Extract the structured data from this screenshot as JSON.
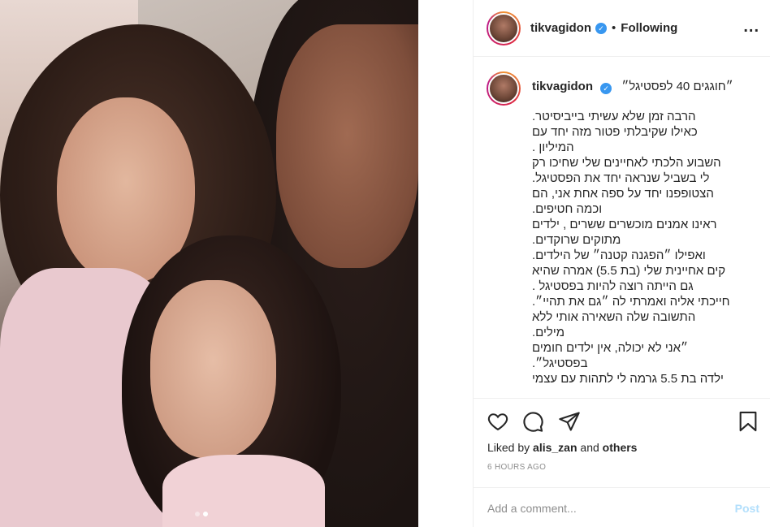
{
  "post": {
    "username": "tikvagidon",
    "separator": "•",
    "follow_status": "Following",
    "more": "...",
    "caption_title": "״חוגגים 40 לפסטיגל״",
    "caption_lines": [
      "הרבה זמן שלא עשיתי בייביסיטר.",
      "כאילו שקיבלתי פטור מזה יחד עם",
      "המיליון .",
      "השבוע הלכתי לאחיינים שלי שחיכו רק",
      "לי בשביל שנראה יחד את הפסטיגל.",
      "הצטופפנו יחד על ספה אחת אני, הם",
      "וכמה חטיפים.",
      "ראינו אמנים מוכשרים ששרים , ילדים",
      "מתוקים שרוקדים.",
      "ואפילו ״הפגנה קטנה״ של הילדים.",
      "קים אחיינית שלי (בת 5.5) אמרה שהיא",
      "גם הייתה רוצה להיות בפסטיגל .",
      "חייכתי אליה ואמרתי לה ״גם את תהיי״.",
      "התשובה שלה השאירה אותי ללא",
      "מילים.",
      "״אני לא יכולה, אין ילדים חומים",
      "בפסטיגל״.",
      "ילדה בת 5.5 גרמה לי לתהות עם עצמי"
    ],
    "liked_prefix": "Liked by",
    "liked_user": "alis_zan",
    "liked_and": "and",
    "liked_others": "others",
    "time_ago": "6 HOURS AGO",
    "comment_placeholder": "Add a comment...",
    "post_button": "Post"
  },
  "colors": {
    "accent": "#3897f0",
    "post_disabled": "#b2dffc",
    "muted": "#8e8e8e"
  },
  "icons": [
    "heart-icon",
    "comment-icon",
    "share-icon",
    "bookmark-icon",
    "verified-icon"
  ],
  "carousel": {
    "count": 2,
    "active": 2
  }
}
